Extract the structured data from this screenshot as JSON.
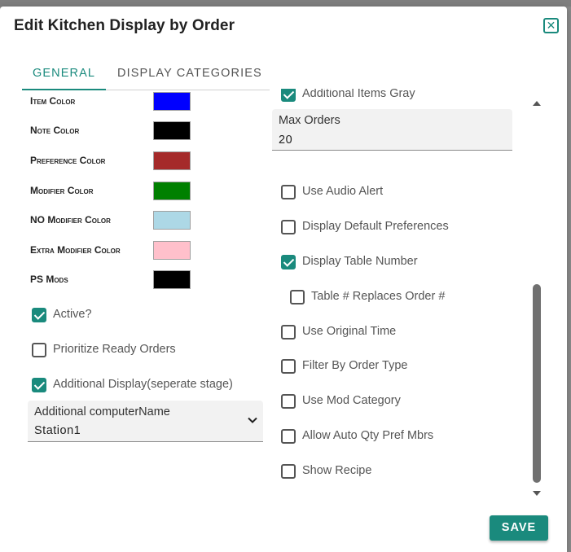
{
  "dialog": {
    "title": "Edit Kitchen Display by Order"
  },
  "tabs": [
    {
      "label": "General",
      "active": true
    },
    {
      "label": "Display Categories",
      "active": false
    }
  ],
  "colors": [
    {
      "label": "Item Color",
      "value": "#0000ff"
    },
    {
      "label": "Note Color",
      "value": "#000000"
    },
    {
      "label": "Preference Color",
      "value": "#a52a2a"
    },
    {
      "label": "Modifier Color",
      "value": "#008000"
    },
    {
      "label": "NO Modifier Color",
      "value": "#add8e6"
    },
    {
      "label": "Extra Modifier Color",
      "value": "#ffc0cb"
    },
    {
      "label": "PS Mods",
      "value": "#000000"
    }
  ],
  "left_checks": [
    {
      "label": "Active?",
      "checked": true
    },
    {
      "label": "Prioritize Ready Orders",
      "checked": false
    },
    {
      "label": "Additional Display(seperate stage)",
      "checked": true
    }
  ],
  "computer_select": {
    "label": "Additional computerName",
    "value": "Station1"
  },
  "right": {
    "top_check": {
      "label": "Additional Items Gray",
      "checked": true
    },
    "max_orders": {
      "label": "Max Orders",
      "value": "20"
    },
    "checks": [
      {
        "label": "Use Audio Alert",
        "checked": false
      },
      {
        "label": "Display Default Preferences",
        "checked": false
      },
      {
        "label": "Display Table Number",
        "checked": true
      },
      {
        "label": "Table # Replaces Order #",
        "checked": false
      },
      {
        "label": "Use Original Time",
        "checked": false
      },
      {
        "label": "Filter By Order Type",
        "checked": false
      },
      {
        "label": "Use Mod Category",
        "checked": false
      },
      {
        "label": "Allow Auto Qty Pref Mbrs",
        "checked": false
      },
      {
        "label": "Show Recipe",
        "checked": false
      }
    ]
  },
  "actions": {
    "save_label": "Save"
  },
  "theme": {
    "accent": "#1a8a7d"
  }
}
